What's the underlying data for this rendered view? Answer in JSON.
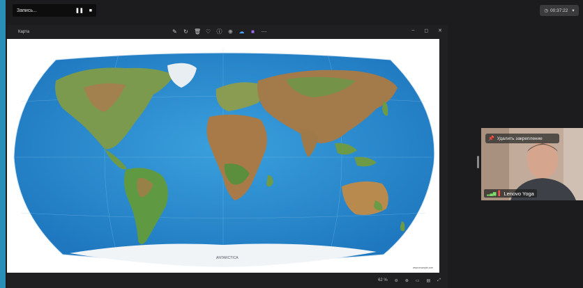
{
  "recording": {
    "label": "Запись...",
    "pause_icon": "pause-icon",
    "stop_icon": "stop-icon"
  },
  "timer": {
    "value": "00:37:22",
    "clock_icon": "clock-icon"
  },
  "viewer": {
    "title": "Карта",
    "tools": [
      "edit-icon",
      "rotate-icon",
      "delete-icon",
      "favorite-icon",
      "info-icon",
      "share-icon",
      "cloud-icon",
      "app-icon",
      "more-icon"
    ],
    "status": {
      "zoom": "62 %"
    },
    "map": {
      "ocean_label": "ANTARCTICA",
      "credit": "www.example.com"
    }
  },
  "participant": {
    "unpin_label": "Удалить закрепление",
    "name": "Lenovo Yoga"
  },
  "colors": {
    "ocean": "#2f8fd0",
    "land_green": "#6f9a4a",
    "land_brown": "#a6794a",
    "ice": "#f2f5f8"
  }
}
